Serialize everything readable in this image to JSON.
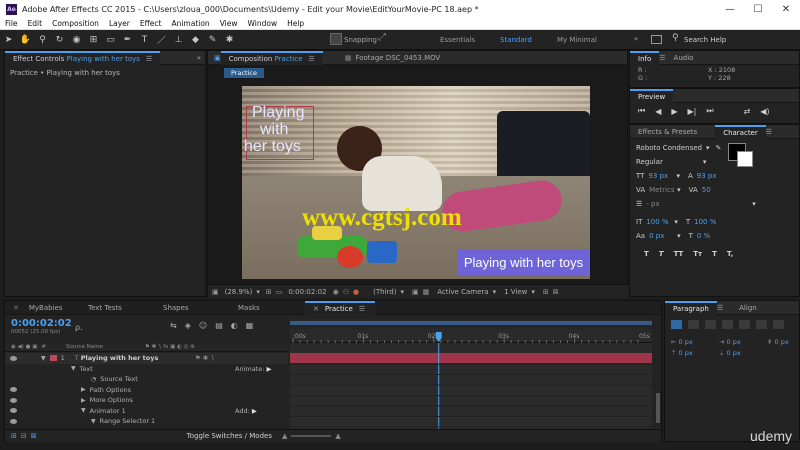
{
  "window": {
    "title": "Adobe After Effects CC 2015 - C:\\Users\\zloua_000\\Documents\\Udemy - Edit your Movie\\EditYourMovie-PC 18.aep *",
    "app_icon": "Ae",
    "minimize": "—",
    "maximize": "☐",
    "close": "✕"
  },
  "menu": [
    "File",
    "Edit",
    "Composition",
    "Layer",
    "Effect",
    "Animation",
    "View",
    "Window",
    "Help"
  ],
  "toolbar": {
    "snapping": "Snapping",
    "workspaces": [
      "Essentials",
      "Standard",
      "My Minimal"
    ],
    "active_workspace": "Standard",
    "search_help": "Search Help",
    "overflow": "»"
  },
  "effects_panel": {
    "tab_prefix": "Effect Controls",
    "tab_layer": "Playing  with  her toys",
    "breadcrumb": "Practice • Playing  with  her toys"
  },
  "comp_panel": {
    "tab_prefix": "Composition",
    "tab_name": "Practice",
    "footage_tab": "Footage DSC_0453.MOV",
    "sub_tab": "Practice",
    "title_overlay": [
      "Playing",
      "with",
      "her toys"
    ],
    "lower_third": "Playing with her toys",
    "watermark": "www.cgtsj.com",
    "zoom": "(28.9%)",
    "timecode": "0:00:02:02",
    "resolution": "(Third)",
    "camera": "Active Camera",
    "views": "1 View"
  },
  "info_panel": {
    "tabs": [
      "Info",
      "Audio"
    ],
    "r_label": "R :",
    "g_label": "G :",
    "x_readout": "X : 2108",
    "y_readout": "Y : 228"
  },
  "preview_panel": {
    "title": "Preview"
  },
  "character_panel": {
    "tabs": [
      "Effects & Presets",
      "Character"
    ],
    "font": "Roboto Condensed",
    "style": "Regular",
    "size": "93 px",
    "leading": "93 px",
    "kerning": "Metrics",
    "tracking": "50",
    "stroke_width": "- px",
    "vert_scale": "100 %",
    "horiz_scale": "100 %",
    "baseline": "0 px",
    "tsume": "0 %",
    "style_buttons": [
      "T",
      "T",
      "TT",
      "Tт",
      "T",
      "T,"
    ]
  },
  "timeline": {
    "tabs": [
      "MyBabies",
      "Text Tests",
      "Shapes",
      "Masks",
      "Practice"
    ],
    "active_tab": "Practice",
    "timecode": "0:00:02:02",
    "frames": "00052 (25.00 fps)",
    "search_placeholder": "ρ.",
    "header_source": "Source Name",
    "ruler": [
      ":00s",
      "01s",
      "02s",
      "03s",
      "04s",
      "05s"
    ],
    "layer_num": "1",
    "layer_name": "Playing  with  her toys",
    "rows": [
      {
        "label": "Text",
        "indent": 1,
        "right": "Animate:"
      },
      {
        "label": "Source Text",
        "indent": 3,
        "right": ""
      },
      {
        "label": "Path Options",
        "indent": 2,
        "right": ""
      },
      {
        "label": "More Options",
        "indent": 2,
        "right": ""
      },
      {
        "label": "Animator 1",
        "indent": 2,
        "right": "Add:"
      },
      {
        "label": "Range Selector 1",
        "indent": 3,
        "right": ""
      }
    ],
    "toggle_label": "Toggle Switches / Modes",
    "playhead": 2.07,
    "duration": 5,
    "watermark_brand": "udemy"
  },
  "paragraph_panel": {
    "tabs": [
      "Paragraph",
      "Align"
    ],
    "values": [
      "0 px",
      "0 px",
      "0 px",
      "0 px",
      "0 px"
    ]
  },
  "colors": {
    "accent": "#4ba0f0",
    "layer_bar": "#9e3548",
    "overlay_text": "#e6e6ff",
    "lower_third_bg": "#6e64d8",
    "watermark": "#f0e000"
  }
}
